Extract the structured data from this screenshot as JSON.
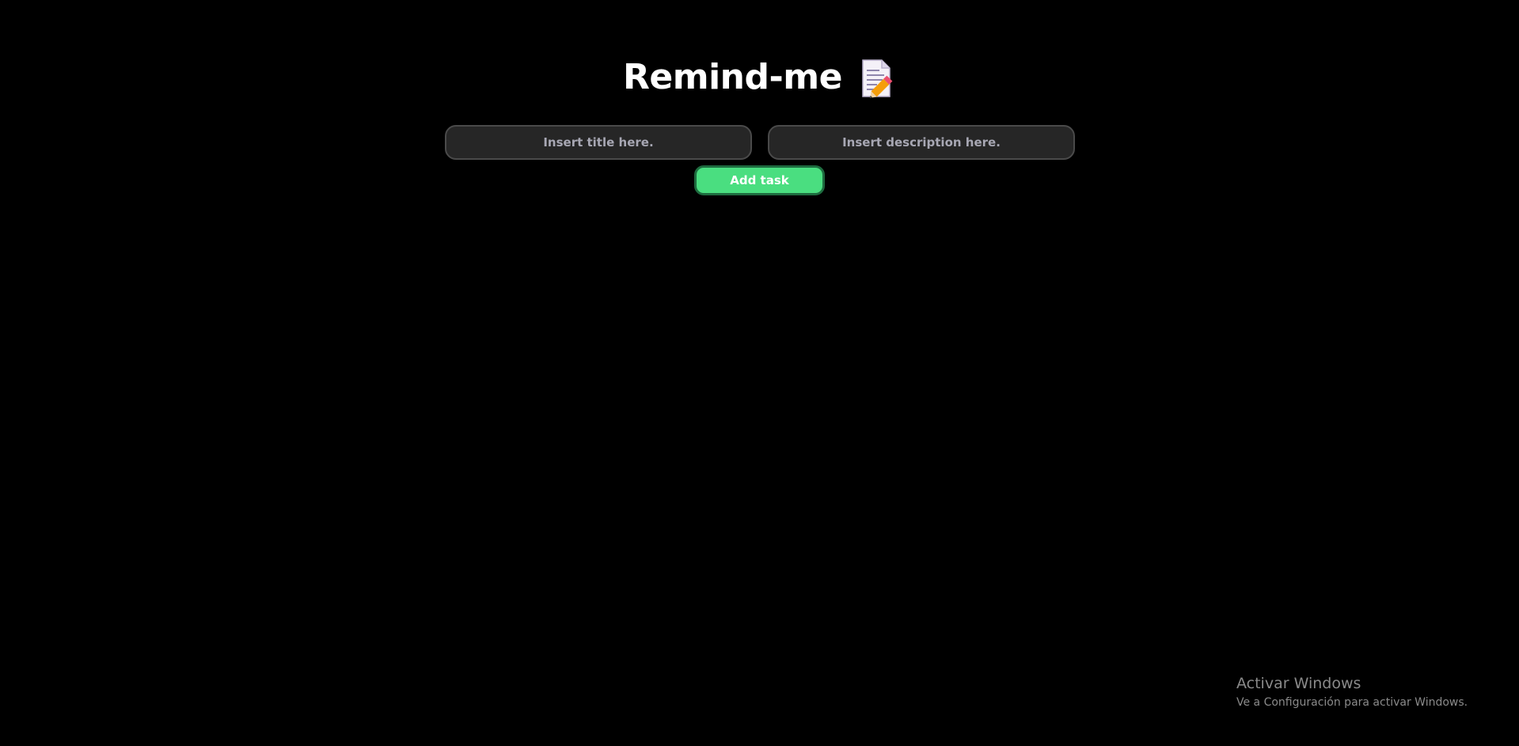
{
  "app": {
    "title": "Remind-me",
    "title_icon": "memo-icon"
  },
  "form": {
    "title_input": {
      "value": "",
      "placeholder": "Insert title here."
    },
    "description_input": {
      "value": "",
      "placeholder": "Insert description here."
    },
    "add_button_label": "Add task"
  },
  "colors": {
    "background": "#000000",
    "input_background": "#262626",
    "input_border": "#4a4a4a",
    "placeholder": "#a7a7b3",
    "accent_green": "#4ade80",
    "accent_green_border": "#1e6b3f"
  },
  "os_watermark": {
    "title": "Activar Windows",
    "subtitle": "Ve a Configuración para activar Windows."
  }
}
